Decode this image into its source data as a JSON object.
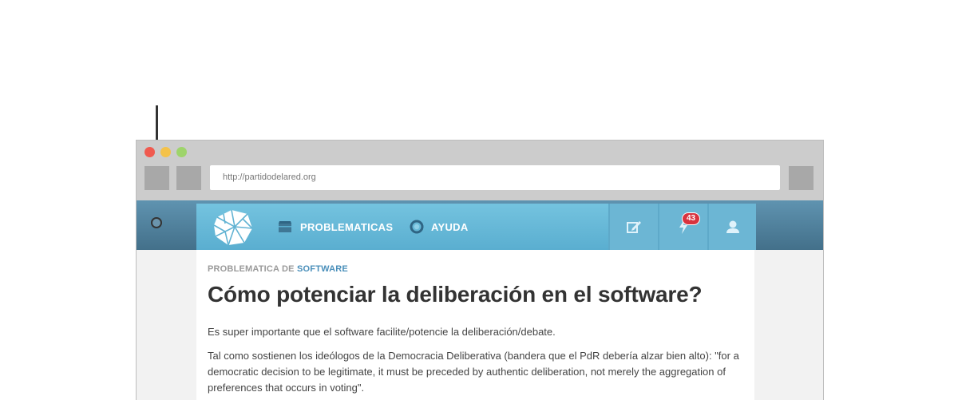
{
  "browser": {
    "url": "http://partidodelared.org"
  },
  "nav": {
    "items": [
      {
        "label": "PROBLEMATICAS",
        "icon": "inbox-icon"
      },
      {
        "label": "AYUDA",
        "icon": "lifebuoy-icon"
      }
    ],
    "actions": {
      "edit_icon": "edit-icon",
      "notifications_icon": "lightning-icon",
      "notification_count": "43",
      "user_icon": "user-icon"
    }
  },
  "article": {
    "category_prefix": "PROBLEMATICA DE",
    "category": "SOFTWARE",
    "title": "Cómo potenciar la deliberación en el software?",
    "paragraphs": [
      "Es super importante que el software facilite/potencie la deliberación/debate.",
      "Tal como sostienen los ideólogos de la Democracia Deliberativa (bandera que el PdR debería alzar bien alto): \"for a democratic decision to be legitimate, it must be preceded by authentic deliberation, not merely the aggregation of preferences that occurs in voting\"."
    ]
  },
  "colors": {
    "header_dark": "#43708a",
    "navbar": "#5aaed0",
    "badge": "#d8333f",
    "accent_link": "#4a8fba"
  }
}
